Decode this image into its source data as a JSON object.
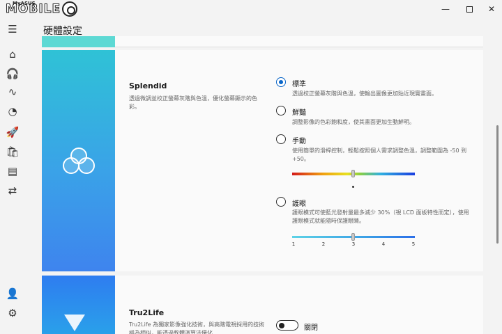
{
  "app": {
    "logo_text": "MOBILE",
    "logo_small": "MyASUS",
    "page_title": "硬體設定"
  },
  "window_controls": {
    "minimize": "—",
    "close": "✕"
  },
  "sidebar": {
    "items": [
      {
        "icon": "menu-icon",
        "glyph": "☰"
      },
      {
        "icon": "home-icon",
        "glyph": "⌂"
      },
      {
        "icon": "headset-icon",
        "glyph": "🎧"
      },
      {
        "icon": "pulse-icon",
        "glyph": "∿"
      },
      {
        "icon": "diagnostics-icon",
        "glyph": "◔"
      },
      {
        "icon": "rocket-icon",
        "glyph": "🚀"
      },
      {
        "icon": "bag-icon",
        "glyph": "🛍"
      },
      {
        "icon": "document-icon",
        "glyph": "▤"
      },
      {
        "icon": "link-icon",
        "glyph": "⇄"
      },
      {
        "icon": "user-icon",
        "glyph": "👤"
      },
      {
        "icon": "settings-icon",
        "glyph": "⚙"
      }
    ]
  },
  "splendid": {
    "title": "Splendid",
    "description": "透過微調並校正螢幕灰階與色溫，優化螢幕顯示的色彩。",
    "options": [
      {
        "label": "標準",
        "desc": "透過校正螢幕灰階與色溫，使輸出圖像更加貼近現實畫面。",
        "selected": true
      },
      {
        "label": "鮮豔",
        "desc": "調整影像的色彩飽和度，使其畫面更加生動鮮明。",
        "selected": false
      },
      {
        "label": "手動",
        "desc": "使用簡單的滑桿控制，輕鬆按照個人需求調整色溫，調整範圍為 -50 到 +50。",
        "selected": false
      },
      {
        "label": "護眼",
        "desc": "護眼模式可使藍光發射量最多減少 30%（視 LCD 面板特性而定），使用護眼模式就能隨時保護眼睛。",
        "selected": false
      }
    ],
    "manual_slider": {
      "min": -50,
      "max": 50,
      "value": 0
    },
    "eye_care_slider": {
      "ticks": [
        "1",
        "2",
        "3",
        "4",
        "5"
      ],
      "value": 3
    }
  },
  "tru2life": {
    "title": "Tru2Life",
    "description": "Tru2Life 為獨家影像強化技術，與高階電視採用的技術極為相似，能透過軟體演算法優化",
    "toggle_label": "關閉",
    "toggle_on": false
  }
}
